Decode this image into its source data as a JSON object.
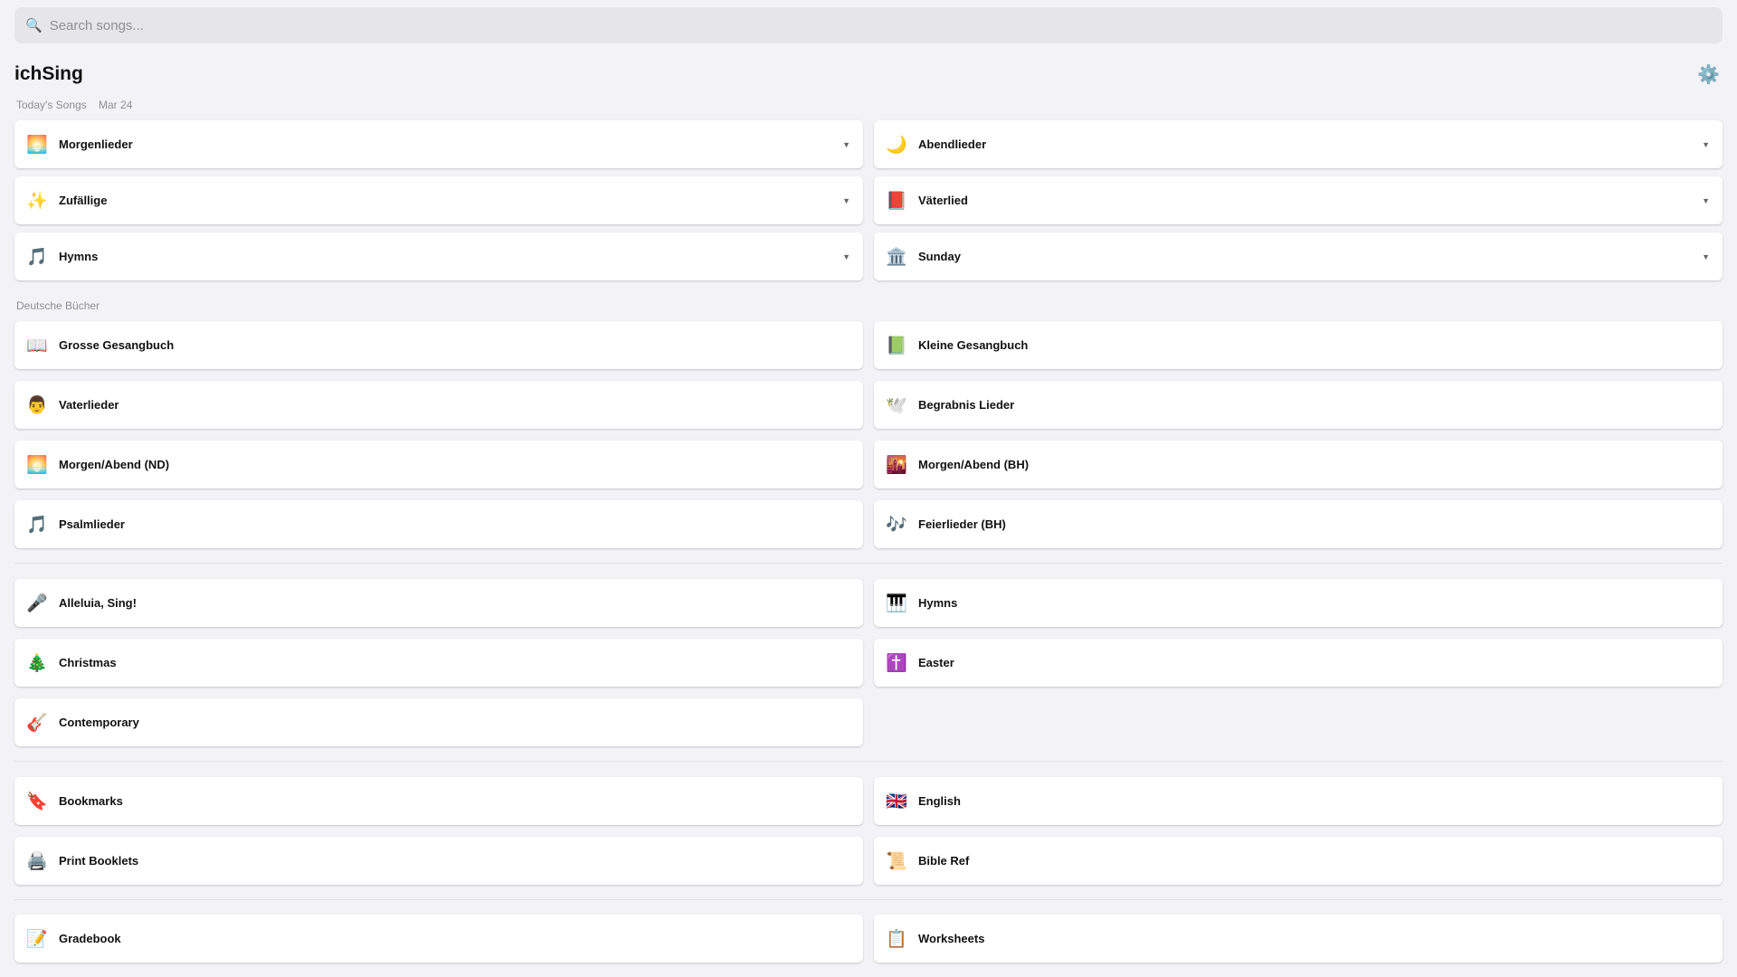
{
  "search": {
    "placeholder": "Search songs...",
    "icon": "search-icon"
  },
  "app_title": "ichSing",
  "settings_icon": "gear-icon",
  "today": {
    "label": "Today's Songs",
    "date": "Mar 24",
    "items": [
      {
        "icon": "🌅",
        "label": "Morgenlieder"
      },
      {
        "icon": "🌙",
        "label": "Abendlieder"
      },
      {
        "icon": "✨",
        "label": "Zufällige"
      },
      {
        "icon": "📕",
        "label": "Väterlied"
      },
      {
        "icon": "🎵",
        "label": "Hymns"
      },
      {
        "icon": "🏛️",
        "label": "Sunday"
      }
    ]
  },
  "german": {
    "label": "Deutsche Bücher",
    "items": [
      {
        "icon": "📖",
        "label": "Grosse Gesangbuch"
      },
      {
        "icon": "📗",
        "label": "Kleine Gesangbuch"
      },
      {
        "icon": "👨",
        "label": "Vaterlieder"
      },
      {
        "icon": "🕊️",
        "label": "Begrabnis Lieder"
      },
      {
        "icon": "🌅",
        "label": "Morgen/Abend (ND)"
      },
      {
        "icon": "🌇",
        "label": "Morgen/Abend (BH)"
      },
      {
        "icon": "🎵",
        "label": "Psalmlieder"
      },
      {
        "icon": "🎶",
        "label": "Feierlieder (BH)"
      }
    ]
  },
  "english": {
    "items": [
      {
        "icon": "🎤",
        "label": "Alleluia, Sing!"
      },
      {
        "icon": "🎹",
        "label": "Hymns"
      },
      {
        "icon": "🎄",
        "label": "Christmas"
      },
      {
        "icon": "✝️",
        "label": "Easter"
      },
      {
        "icon": "🎸",
        "label": "Contemporary"
      }
    ]
  },
  "tools": {
    "items": [
      {
        "icon": "🔖",
        "label": "Bookmarks"
      },
      {
        "icon": "🇬🇧",
        "label": "English"
      },
      {
        "icon": "🖨️",
        "label": "Print Booklets"
      },
      {
        "icon": "📜",
        "label": "Bible Ref"
      }
    ]
  },
  "school": {
    "items": [
      {
        "icon": "📝",
        "label": "Gradebook"
      },
      {
        "icon": "📋",
        "label": "Worksheets"
      }
    ]
  }
}
